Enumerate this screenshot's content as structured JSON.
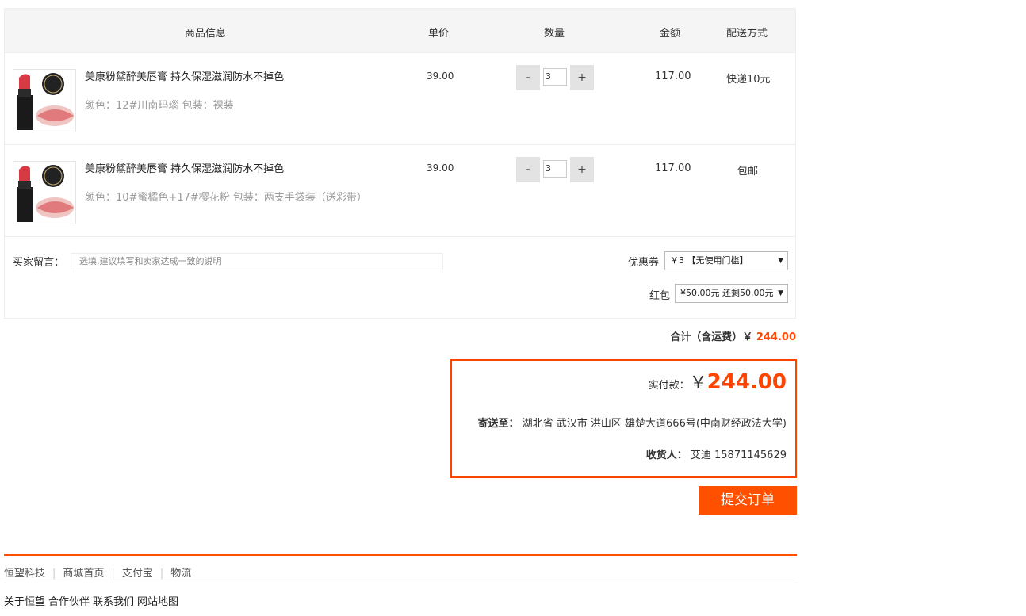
{
  "header": {
    "product_info": "商品信息",
    "unit_price": "单价",
    "quantity": "数量",
    "amount": "金额",
    "delivery": "配送方式"
  },
  "items": [
    {
      "title": "美康粉黛醉美唇膏 持久保湿滋润防水不掉色",
      "attrs": "颜色：12#川南玛瑙 包装：裸装",
      "price": "39.00",
      "qty": "3",
      "amount": "117.00",
      "shipping": "快递10元",
      "image": "lipstick-product-image"
    },
    {
      "title": "美康粉黛醉美唇膏 持久保湿滋润防水不掉色",
      "attrs": "颜色：10#蜜橘色+17#樱花粉 包装：两支手袋装（送彩带）",
      "price": "39.00",
      "qty": "3",
      "amount": "117.00",
      "shipping": "包邮",
      "image": "lipstick-product-image"
    }
  ],
  "qty_controls": {
    "minus": "-",
    "plus": "+"
  },
  "message": {
    "label": "买家留言：",
    "placeholder": "选填,建议填写和卖家达成一致的说明"
  },
  "coupon": {
    "label": "优惠券",
    "value": "￥3 【无使用门槛】"
  },
  "red_packet": {
    "label": "红包",
    "value": "¥50.00元 还剩50.00元"
  },
  "total": {
    "label": "合计（含运费）￥",
    "value": "244.00"
  },
  "payment": {
    "label": "实付款：",
    "currency": "￥",
    "value": "244.00",
    "ship_to_label": "寄送至：",
    "ship_to": "湖北省 武汉市 洪山区 雄楚大道666号(中南财经政法大学)",
    "receiver_label": "收货人：",
    "receiver": "艾迪 15871145629"
  },
  "submit_label": "提交订单",
  "footer_nav": [
    "恒望科技",
    "商城首页",
    "支付宝",
    "物流"
  ],
  "footer_links": [
    "关于恒望",
    "合作伙伴",
    "联系我们",
    "网站地图"
  ],
  "colors": {
    "accent": "#ff5000",
    "price_red": "#ff4400"
  }
}
